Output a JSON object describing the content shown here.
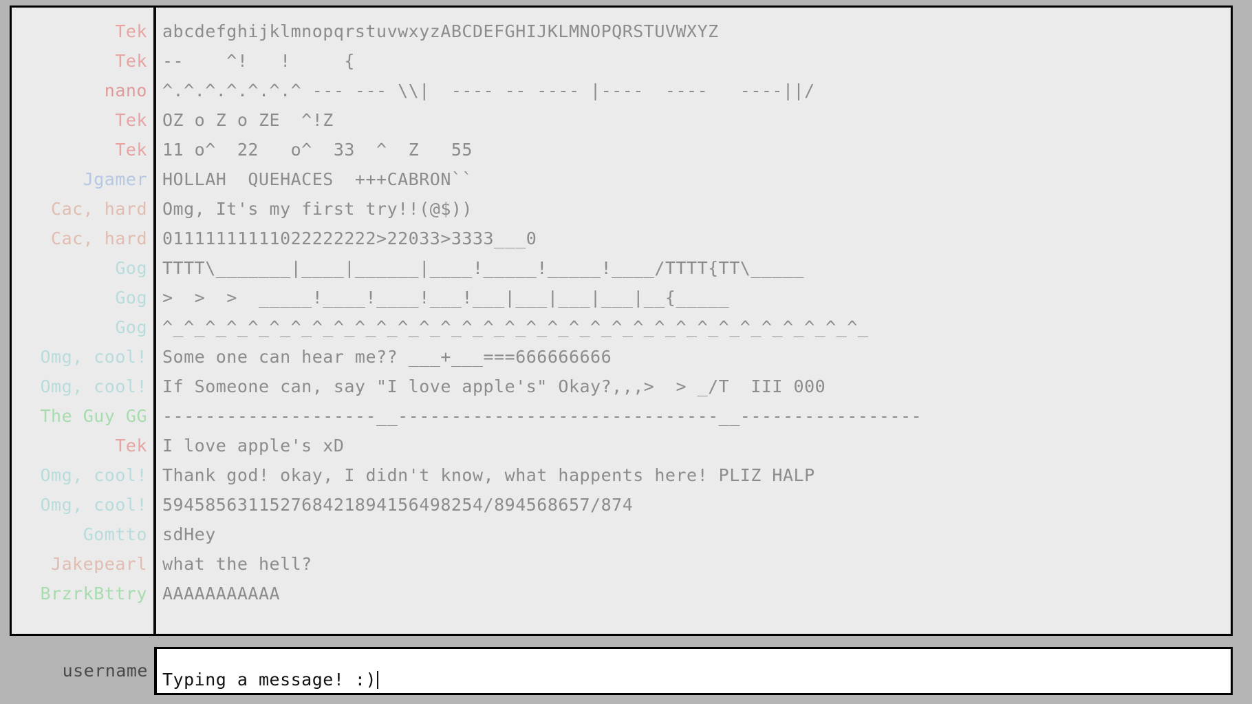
{
  "window": {
    "background_color": "#b4b4b4",
    "panel_background_color": "#ebebeb",
    "border_color": "#000000",
    "message_text_color": "#8c8c8c"
  },
  "chat": {
    "messages": [
      {
        "user": "Tek",
        "color": "#e8a3a3",
        "text": "abcdefghijklmnopqrstuvwxyzABCDEFGHIJKLMNOPQRSTUVWXYZ"
      },
      {
        "user": "Tek",
        "color": "#e8a3a3",
        "text": "--    ^!   !     {"
      },
      {
        "user": "nano",
        "color": "#e09a9a",
        "text": "^.^.^.^.^.^.^ --- --- \\\\|  ---- -- ---- |----  ----   ----||/"
      },
      {
        "user": "Tek",
        "color": "#e8a3a3",
        "text": "OZ o Z o ZE  ^!Z"
      },
      {
        "user": "Tek",
        "color": "#e8a3a3",
        "text": "11 o^  22   o^  33  ^  Z   55"
      },
      {
        "user": "Jgamer",
        "color": "#b6c8e2",
        "text": "HOLLAH  QUEHACES  +++CABRON``"
      },
      {
        "user": "Cac, hard",
        "color": "#e0bdb0",
        "text": "Omg, It's my first try!!(@$))"
      },
      {
        "user": "Cac, hard",
        "color": "#e0bdb0",
        "text": "01111111111022222222>22033>3333___0"
      },
      {
        "user": "Gog",
        "color": "#b8dcdc",
        "text": "TTTT\\_______|____|______|____!_____!_____!____/TTTT{TT\\_____"
      },
      {
        "user": "Gog",
        "color": "#b8dcdc",
        "text": ">  >  >  _____!____!____!___!___|___|___|___|__{_____"
      },
      {
        "user": "Gog",
        "color": "#b8dcdc",
        "text": "^_^_^_^_^_^_^_^_^_^_^_^_^_^_^_^_^_^_^_^_^_^_^_^_^_^_^_^_^_^_^_^_^_"
      },
      {
        "user": "Omg, cool!",
        "color": "#b8dcdc",
        "text": "Some one can hear me?? ___+___===666666666"
      },
      {
        "user": "Omg, cool!",
        "color": "#b8dcdc",
        "text": "If Someone can, say \"I love apple's\" Okay?,,,>  > _/T  III 000"
      },
      {
        "user": "The Guy GG",
        "color": "#a6dcae",
        "text": "--------------------__------------------------------__-----------------"
      },
      {
        "user": "Tek",
        "color": "#e8a3a3",
        "text": "I love apple's xD"
      },
      {
        "user": "Omg, cool!",
        "color": "#b8dcdc",
        "text": "Thank god! okay, I didn't know, what happents here! PLIZ HALP"
      },
      {
        "user": "Omg, cool!",
        "color": "#b8dcdc",
        "text": "594585631152768421894156498254/894568657/874"
      },
      {
        "user": "Gomtto",
        "color": "#b8dcdc",
        "text": "sdHey"
      },
      {
        "user": "Jakepearl",
        "color": "#e0bdb0",
        "text": "what the hell?"
      },
      {
        "user": "BrzrkBttry",
        "color": "#a6dcae",
        "text": "AAAAAAAAAAA"
      }
    ]
  },
  "composer": {
    "username_label": "username",
    "input_value": "Typing a message! :)",
    "input_placeholder": ""
  }
}
